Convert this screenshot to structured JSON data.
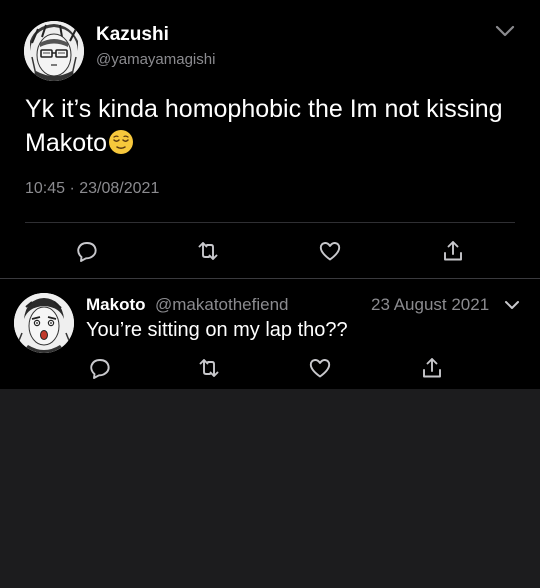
{
  "main_tweet": {
    "display_name": "Kazushi",
    "handle": "@yamayamagishi",
    "text": "Yk it’s kinda homophobic the Im not kissing Makoto",
    "emoji": "relieved-face-emoji",
    "timestamp": "10:45 · 23/08/2021",
    "avatar_icon": "anime-avatar-glasses"
  },
  "reply_tweet": {
    "display_name": "Makoto",
    "handle": "@makatothefiend",
    "date": "23 August 2021",
    "text": "You’re sitting on my lap tho??",
    "avatar_icon": "anime-avatar-shocked"
  },
  "icons": {
    "reply": "reply-icon",
    "retweet": "retweet-icon",
    "like": "heart-icon",
    "share": "share-icon",
    "menu": "chevron-down-icon"
  },
  "colors": {
    "background": "#000000",
    "empty_area": "#1c1c1e",
    "secondary_text": "#8b8b8f",
    "icon_gray": "#c8c8cc"
  }
}
